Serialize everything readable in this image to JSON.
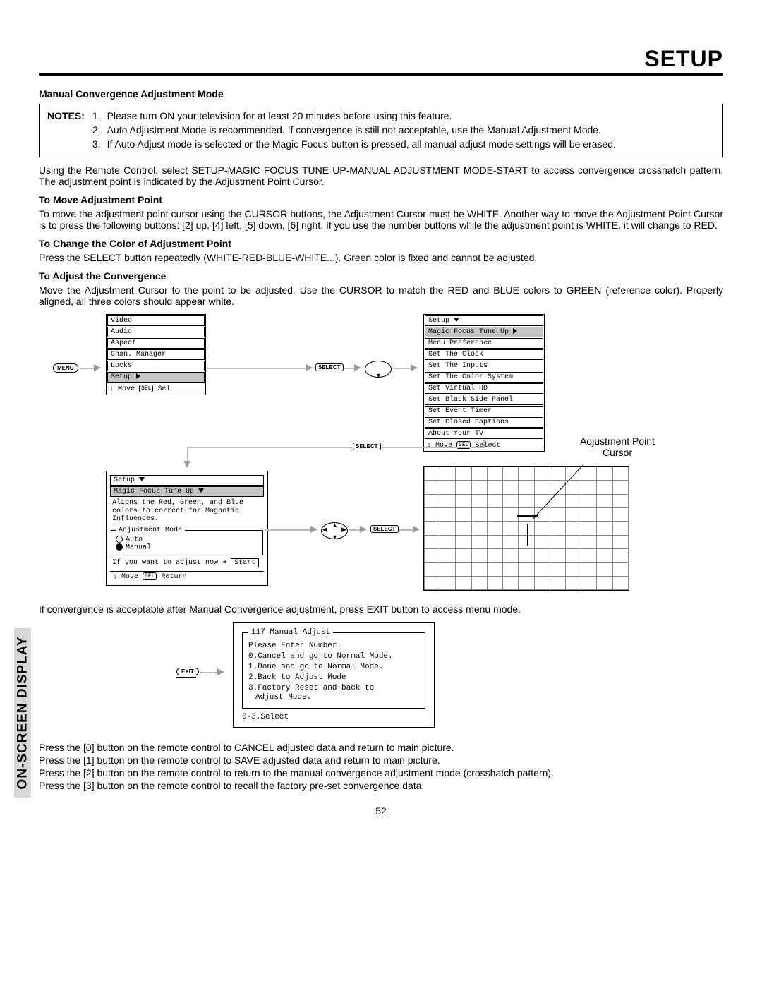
{
  "header": {
    "title": "SETUP"
  },
  "sidebar": {
    "label": "ON-SCREEN DISPLAY"
  },
  "page_number": "52",
  "sections": {
    "s1_title": "Manual Convergence Adjustment Mode",
    "notes_label": "NOTES:",
    "notes": {
      "n1_num": "1.",
      "n1": "Please turn ON your television for at least 20 minutes before using this feature.",
      "n2_num": "2.",
      "n2": "Auto Adjustment Mode is recommended.  If convergence is still not acceptable, use the Manual Adjustment Mode.",
      "n3_num": "3.",
      "n3": "If Auto Adjust mode is selected or the Magic Focus button is pressed, all manual adjust mode settings will be erased."
    },
    "p1": "Using the Remote Control, select SETUP-MAGIC FOCUS TUNE UP-MANUAL ADJUSTMENT MODE-START to access convergence crosshatch pattern.  The adjustment point is indicated by the Adjustment Point Cursor.",
    "s2_title": "To Move Adjustment Point",
    "p2": "To move the adjustment point cursor using the CURSOR buttons, the Adjustment Cursor must be WHITE.  Another way to move the Adjustment Point Cursor is to press the following buttons:  [2] up, [4] left, [5] down, [6] right.  If you use the number buttons while the adjustment point is WHITE, it will change to RED.",
    "s3_title": "To Change the Color of Adjustment Point",
    "p3": "Press the SELECT button repeatedly (WHITE-RED-BLUE-WHITE...).  Green color is fixed and cannot be adjusted.",
    "s4_title": "To Adjust the Convergence",
    "p4": "Move the Adjustment Cursor to the point to be adjusted.  Use the CURSOR to match the RED and BLUE colors to GREEN (reference color).  Properly aligned, all three colors should appear white.",
    "p5": "If convergence is acceptable after Manual Convergence adjustment, press EXIT button to access menu mode.",
    "p6": "Press the [0] button on the remote control to CANCEL adjusted data and return to main picture.",
    "p7": "Press the [1] button on the remote control to SAVE adjusted data and return to main picture.",
    "p8": "Press the [2] button on the remote control to return to the manual convergence adjustment mode (crosshatch pattern).",
    "p9": "Press the [3] button on the remote control to recall the factory pre-set convergence data."
  },
  "badges": {
    "menu": "MENU",
    "select": "SELECT",
    "exit": "EXIT"
  },
  "menu1": {
    "items": [
      "Video",
      "Audio",
      "Aspect",
      "Chan. Manager",
      "Locks",
      "Setup"
    ],
    "hint_move": "Move",
    "hint_sel": "Sel",
    "selected_index": 5
  },
  "menu2": {
    "title": "Setup",
    "items": [
      "Magic Focus Tune Up",
      "Menu Preference",
      "Set The Clock",
      "Set The Inputs",
      "Set The Color System",
      "Set Virtual HD",
      "Set Black Side Panel",
      "Set Event Timer",
      "Set Closed Captions",
      "About Your TV"
    ],
    "hint_move": "Move",
    "hint_sel": "Select",
    "selected_index": 0
  },
  "magic": {
    "title": "Setup",
    "subtitle": "Magic Focus Tune Up",
    "desc1": "Aligns the Red, Green, and Blue",
    "desc2": "colors to correct for Magnetic",
    "desc3": "Influences.",
    "legend": "Adjustment Mode",
    "opt_auto": "Auto",
    "opt_manual": "Manual",
    "prompt": "If you want to adjust now",
    "start": "Start",
    "hint_move": "Move",
    "hint_ret": "Return"
  },
  "grid_label": {
    "l1": "Adjustment Point",
    "l2": "Cursor"
  },
  "exitmenu": {
    "legend": "117 Manual Adjust",
    "line1": "Please Enter Number.",
    "opt0": "0.Cancel and go to Normal Mode.",
    "opt1": "1.Done and go to Normal Mode.",
    "opt2": "2.Back to Adjust Mode",
    "opt3a": "3.Factory Reset and back to",
    "opt3b": "  Adjust Mode.",
    "footer": "0-3.Select"
  }
}
